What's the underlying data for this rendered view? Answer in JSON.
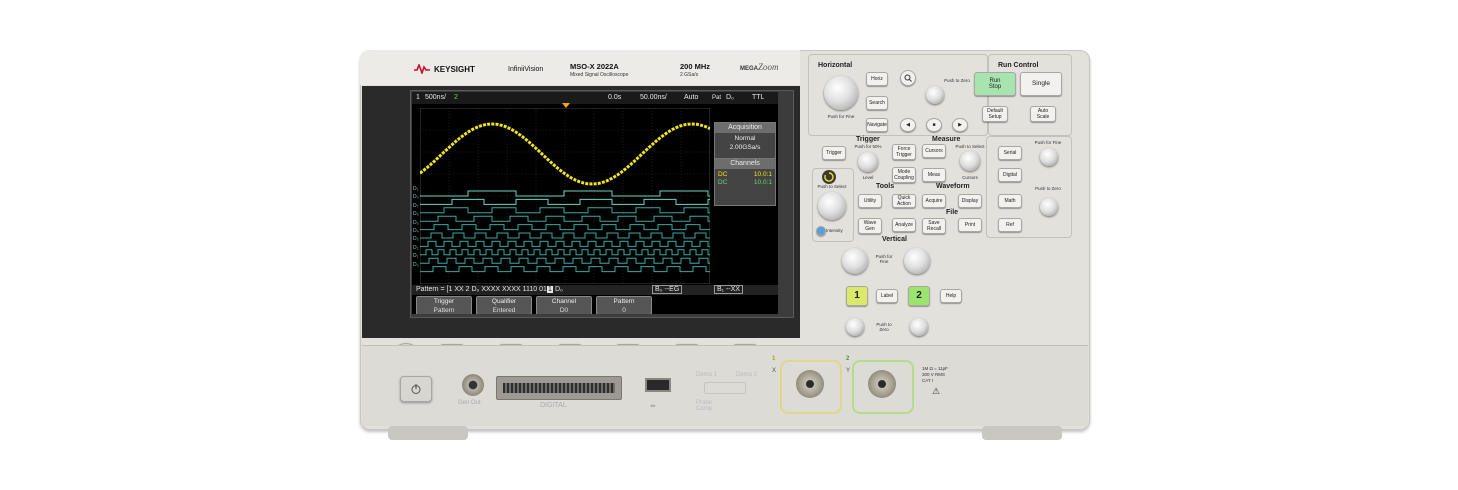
{
  "brand": {
    "logo_text": "KEYSIGHT",
    "series": "InfiniiVision",
    "model": "MSO-X 2022A",
    "model_subtitle": "Mixed Signal Oscilloscope",
    "bandwidth": "200 MHz",
    "sample_rate": "2 GSa/s",
    "megazoom_prefix": "MEGA",
    "megazoom_suffix": "Zoom"
  },
  "screen": {
    "status": {
      "ch1": "1",
      "timebase": "500ns/",
      "ch2": "2",
      "delay": "0.0s",
      "time_div": "50.00ns/",
      "trigger_mode": "Auto",
      "pat": "Pat",
      "d0": "D₀",
      "level": "TTL"
    },
    "acquisition": {
      "title": "Acquisition",
      "mode": "Normal",
      "rate": "2.00GSa/s"
    },
    "channels": {
      "title": "Channels",
      "rows": [
        {
          "coupling": "DC",
          "probe": "10.0:1"
        },
        {
          "coupling": "DC",
          "probe": "10.0:1"
        }
      ]
    },
    "pattern_line": "Pattern = [1 XX 2 D₀ XXXX XXXX 1110 011",
    "pattern_cursor": "1",
    "pattern_tail": "D₀",
    "box1": "B₀ --EG",
    "box2": "B₁ --XX",
    "digital_labels": [
      "D₁",
      "D₀",
      "D₇",
      "D₆",
      "D₅",
      "D₄",
      "D₃",
      "D₂",
      "D₁",
      "D₀"
    ],
    "softkeys": [
      {
        "label": "Trigger",
        "value": "Pattern"
      },
      {
        "label": "Qualifier",
        "value": "Entered"
      },
      {
        "label": "Channel",
        "value": "D0"
      },
      {
        "label": "Pattern",
        "value": "0"
      }
    ]
  },
  "panel": {
    "horizontal": {
      "title": "Horizontal",
      "horiz": "Horiz",
      "search": "Search",
      "navigate": "Navigate",
      "push_for_fine": "Push for Fine",
      "push_to_zero": "Push to Zero"
    },
    "run_control": {
      "title": "Run Control",
      "run": "Run",
      "stop": "Stop",
      "single": "Single",
      "default_setup": "Default Setup",
      "auto_scale": "Auto Scale"
    },
    "trigger": {
      "title": "Trigger",
      "trigger": "Trigger",
      "force_trigger": "Force Trigger",
      "mode_coupling": "Mode Coupling",
      "level": "Level",
      "push_for_50": "Push for 50%"
    },
    "measure": {
      "title": "Measure",
      "cursors_btn": "Cursors",
      "meas": "Meas",
      "cursors": "Cursors",
      "push_to_select": "Push to Select"
    },
    "tools": {
      "title": "Tools",
      "utility": "Utility",
      "quick_action": "Quick Action",
      "wave_gen": "Wave Gen",
      "analyze": "Analyze"
    },
    "waveform": {
      "title": "Waveform",
      "acquire": "Acquire",
      "display": "Display"
    },
    "file": {
      "title": "File",
      "save_recall": "Save Recall",
      "print": "Print"
    },
    "entry": {
      "push_to_select": "Push to Select",
      "intensity": "Intensity"
    },
    "right_column": {
      "serial": "Serial",
      "digital": "Digital",
      "math": "Math",
      "ref": "Ref",
      "push_for_fine": "Push for Fine",
      "push_to_zero": "Push to Zero"
    },
    "vertical": {
      "title": "Vertical",
      "ch1": "1",
      "ch2": "2",
      "label": "Label",
      "help": "Help",
      "push_for_fine": "Push for Fine",
      "push_to_zero": "Push to Zero"
    }
  },
  "lower": {
    "back": "Back",
    "gen_out": "Gen Out",
    "digital": "DIGITAL",
    "usb": "⬌",
    "demo1": "Demo 1",
    "demo2": "Demo 2",
    "probe_comp": "Probe Comp",
    "ch1_num": "1",
    "ch1_axis": "X",
    "ch2_num": "2",
    "ch2_axis": "Y",
    "input_spec1": "1M Ω = 11pF",
    "input_spec2": "300 V RMS",
    "input_spec3": "CAT I",
    "warning": "⚠"
  },
  "colors": {
    "ch1": "#f2e41a",
    "digital": "#3aa8a3",
    "digital_bright": "#69d8c8",
    "run_green": "#8fd99a",
    "channel1_key": "#d8e85a",
    "channel2_key": "#8ee06a"
  }
}
